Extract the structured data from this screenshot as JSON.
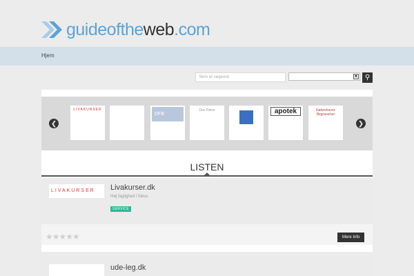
{
  "logo": {
    "part1": "guideofthe",
    "part2": "web",
    ".com": ".com",
    "brand_color": "#5aa3d8"
  },
  "nav": {
    "items": [
      {
        "label": "Hjem"
      }
    ]
  },
  "search": {
    "placeholder": "Skriv et søgeord",
    "select_value": "",
    "button_icon": "search-icon"
  },
  "carousel": {
    "thumbs": [
      {
        "label": "LIVAKURSER"
      },
      {
        "label": ""
      },
      {
        "label": "DFB"
      },
      {
        "label": "Den Pølse"
      },
      {
        "label": ""
      },
      {
        "label": "apotek"
      },
      {
        "label": "Københavns Begravelser"
      }
    ]
  },
  "section_title": "LISTEN",
  "listings": [
    {
      "title": "Livakurser.dk",
      "subtitle": "Høj faglighed i fokus",
      "badge": "SERVICE",
      "logo_text": "LIVAKURSER",
      "rating": 0,
      "more": "Mere Info"
    },
    {
      "title": "ude-leg.dk"
    }
  ]
}
